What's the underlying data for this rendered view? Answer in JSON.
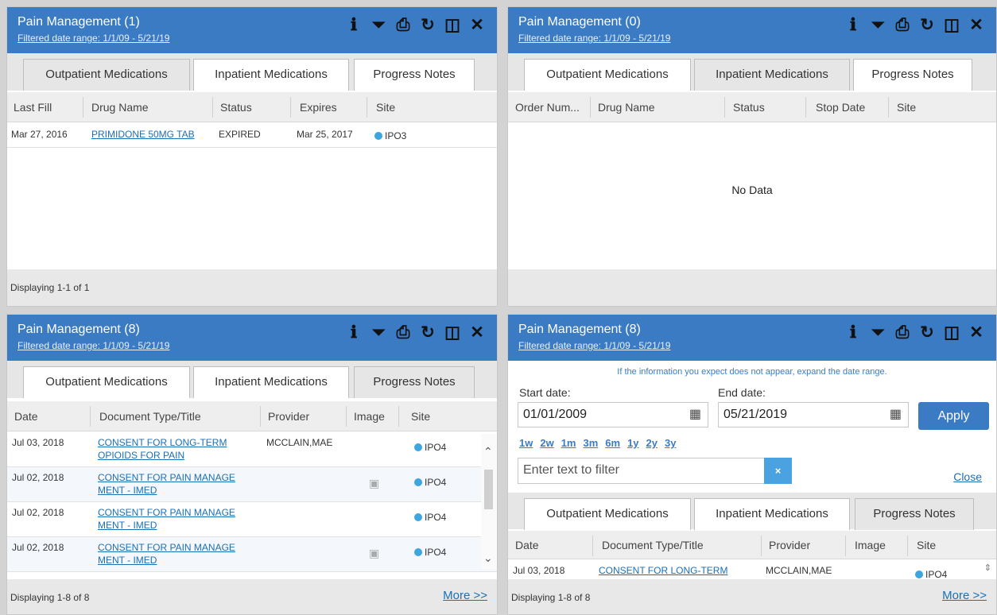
{
  "colors": {
    "header": "#3a7bc4",
    "link": "#1a6fb5",
    "site_dot": "#3da5e0"
  },
  "icons": [
    "info-icon",
    "filter-icon",
    "print-icon",
    "refresh-icon",
    "maximize-icon",
    "close-icon"
  ],
  "applets": [
    {
      "title": "Pain Management (1)",
      "range": "Filtered date range: 1/1/09 - 5/21/19",
      "tabs": [
        "Outpatient Medications",
        "Inpatient Medications",
        "Progress Notes"
      ],
      "columns": [
        "Last Fill",
        "Drug Name",
        "Status",
        "Expires",
        "Site"
      ],
      "rows": [
        [
          "Mar 27, 2016",
          "PRIMIDONE 50MG TAB",
          "EXPIRED",
          "Mar 25, 2017",
          "IPO3"
        ]
      ],
      "footer": "Displaying 1-1 of 1"
    },
    {
      "title": "Pain Management (0)",
      "range": "Filtered date range: 1/1/09 - 5/21/19",
      "tabs": [
        "Outpatient Medications",
        "Inpatient Medications",
        "Progress Notes"
      ],
      "columns": [
        "Order Num...",
        "Drug Name",
        "Status",
        "Stop Date",
        "Site"
      ],
      "empty": "No Data"
    },
    {
      "title": "Pain Management (8)",
      "range": "Filtered date range: 1/1/09 - 5/21/19",
      "tabs": [
        "Outpatient Medications",
        "Inpatient Medications",
        "Progress Notes"
      ],
      "columns": [
        "Date",
        "Document Type/Title",
        "Provider",
        "Image",
        "Site"
      ],
      "rows": [
        [
          "Jul 03, 2018",
          "CONSENT FOR LONG-TERM",
          "OPIOIDS FOR PAIN",
          "MCCLAIN,MAE",
          "IPO4"
        ],
        [
          "Jul 02, 2018",
          "CONSENT FOR PAIN MANAGE",
          "MENT - IMED",
          "",
          "IPO4"
        ],
        [
          "Jul 02, 2018",
          "CONSENT FOR PAIN MANAGE",
          "MENT - IMED",
          "",
          "IPO4"
        ],
        [
          "Jul 02, 2018",
          "CONSENT FOR PAIN MANAGE",
          "MENT - IMED",
          "",
          "IPO4"
        ]
      ],
      "footer": "Displaying 1-8 of 8",
      "more": "More >>"
    },
    {
      "title": "Pain Management (8)",
      "range": "Filtered date range: 1/1/09 - 5/21/19",
      "hint": "If the information you expect does not appear, expand the date range.",
      "start_label": "Start date:",
      "end_label": "End date:",
      "start_value": "01/01/2009",
      "end_value": "05/21/2019",
      "apply": "Apply",
      "quick": [
        "1w",
        "2w",
        "1m",
        "3m",
        "6m",
        "1y",
        "2y",
        "3y"
      ],
      "filter_placeholder": "Enter text to filter",
      "clear": "×",
      "close": "Close",
      "tabs": [
        "Outpatient Medications",
        "Inpatient Medications",
        "Progress Notes"
      ],
      "columns": [
        "Date",
        "Document Type/Title",
        "Provider",
        "Image",
        "Site"
      ],
      "rows": [
        [
          "Jul 03, 2018",
          "CONSENT FOR LONG-TERM",
          "MCCLAIN,MAE",
          "",
          "IPO4"
        ]
      ],
      "footer": "Displaying 1-8 of 8",
      "more": "More >>"
    }
  ]
}
